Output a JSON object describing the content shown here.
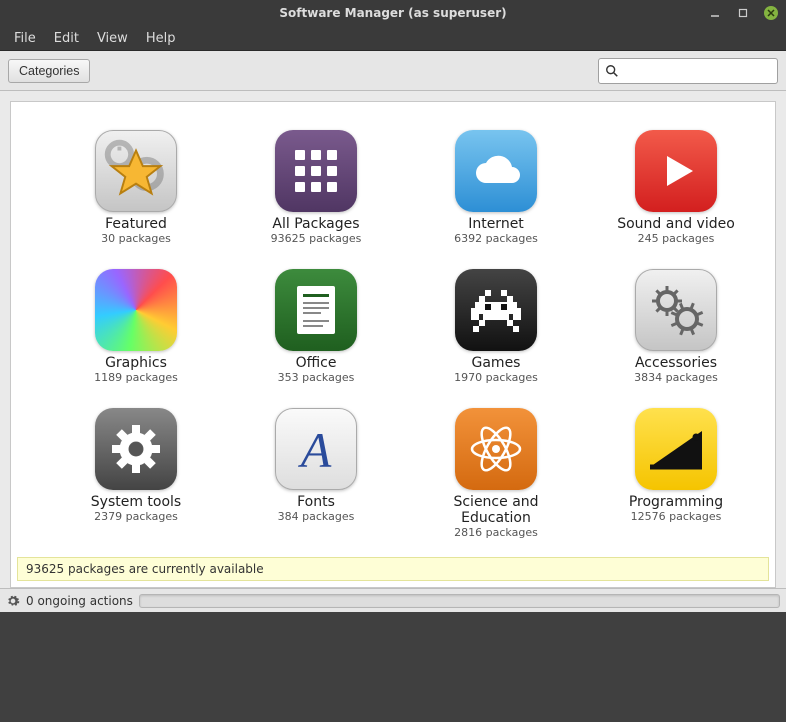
{
  "window": {
    "title": "Software Manager (as superuser)"
  },
  "menubar": {
    "file": "File",
    "edit": "Edit",
    "view": "View",
    "help": "Help"
  },
  "toolbar": {
    "categories_label": "Categories",
    "search_placeholder": ""
  },
  "categories": [
    {
      "key": "featured",
      "label": "Featured",
      "sub": "30 packages",
      "icon": "featured",
      "bg": "bg-featured"
    },
    {
      "key": "all",
      "label": "All Packages",
      "sub": "93625 packages",
      "icon": "grid",
      "bg": "bg-all"
    },
    {
      "key": "internet",
      "label": "Internet",
      "sub": "6392 packages",
      "icon": "cloud",
      "bg": "bg-internet"
    },
    {
      "key": "sound",
      "label": "Sound and video",
      "sub": "245 packages",
      "icon": "play",
      "bg": "bg-sound"
    },
    {
      "key": "graphics",
      "label": "Graphics",
      "sub": "1189 packages",
      "icon": "rainbow",
      "bg": "bg-graphics"
    },
    {
      "key": "office",
      "label": "Office",
      "sub": "353 packages",
      "icon": "document",
      "bg": "bg-office"
    },
    {
      "key": "games",
      "label": "Games",
      "sub": "1970 packages",
      "icon": "invader",
      "bg": "bg-games"
    },
    {
      "key": "accessories",
      "label": "Accessories",
      "sub": "3834 packages",
      "icon": "gears",
      "bg": "bg-accessories"
    },
    {
      "key": "system",
      "label": "System tools",
      "sub": "2379 packages",
      "icon": "gear",
      "bg": "bg-system"
    },
    {
      "key": "fonts",
      "label": "Fonts",
      "sub": "384 packages",
      "icon": "letter-a",
      "bg": "bg-fonts"
    },
    {
      "key": "science",
      "label": "Science and Education",
      "sub": "2816 packages",
      "icon": "atom",
      "bg": "bg-science"
    },
    {
      "key": "programming",
      "label": "Programming",
      "sub": "12576 packages",
      "icon": "triangle",
      "bg": "bg-programming"
    }
  ],
  "status": {
    "banner": "93625 packages are currently available"
  },
  "footer": {
    "ongoing": "0 ongoing actions"
  }
}
